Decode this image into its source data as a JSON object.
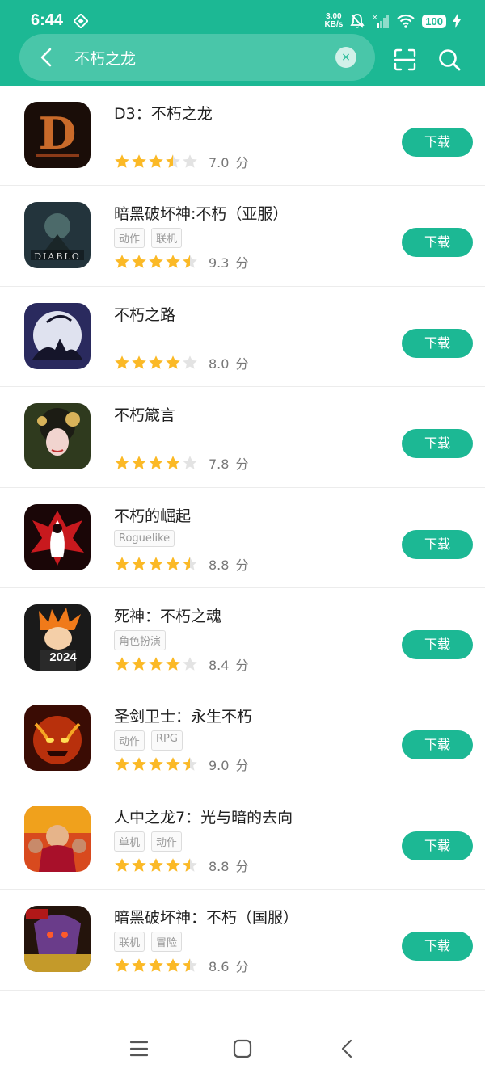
{
  "status_bar": {
    "time": "6:44",
    "net_speed_value": "3.00",
    "net_speed_unit": "KB/s",
    "battery": "100"
  },
  "search": {
    "query": "不朽之龙",
    "clear_label": "×"
  },
  "colors": {
    "accent": "#1cb894",
    "star": "#fbb926",
    "star_empty": "#e3e3e3"
  },
  "download_label": "下载",
  "score_unit": "分",
  "apps": [
    {
      "title": "D3：不朽之龙",
      "tags": [],
      "rating": 3.5,
      "score": "7.0"
    },
    {
      "title": "暗黑破坏神:不朽（亚服）",
      "tags": [
        "动作",
        "联机"
      ],
      "rating": 4.5,
      "score": "9.3"
    },
    {
      "title": "不朽之路",
      "tags": [],
      "rating": 4,
      "score": "8.0"
    },
    {
      "title": "不朽箴言",
      "tags": [],
      "rating": 4,
      "score": "7.8"
    },
    {
      "title": "不朽的崛起",
      "tags": [
        "Roguelike"
      ],
      "rating": 4.5,
      "score": "8.8"
    },
    {
      "title": "死神：不朽之魂",
      "tags": [
        "角色扮演"
      ],
      "rating": 4,
      "score": "8.4"
    },
    {
      "title": "圣剑卫士：永生不朽",
      "tags": [
        "动作",
        "RPG"
      ],
      "rating": 4.5,
      "score": "9.0"
    },
    {
      "title": "人中之龙7：光与暗的去向",
      "tags": [
        "单机",
        "动作"
      ],
      "rating": 4.5,
      "score": "8.8"
    },
    {
      "title": "暗黑破坏神：不朽（国服）",
      "tags": [
        "联机",
        "冒险"
      ],
      "rating": 4.5,
      "score": "8.6"
    }
  ],
  "app_icon_names": [
    "d3-logo-icon",
    "diablo-knight-icon",
    "moon-silhouette-icon",
    "flower-lady-icon",
    "red-demon-icon",
    "anime-hero-icon",
    "fire-demon-icon",
    "yakuza-crowd-icon",
    "dragon-beast-icon"
  ]
}
